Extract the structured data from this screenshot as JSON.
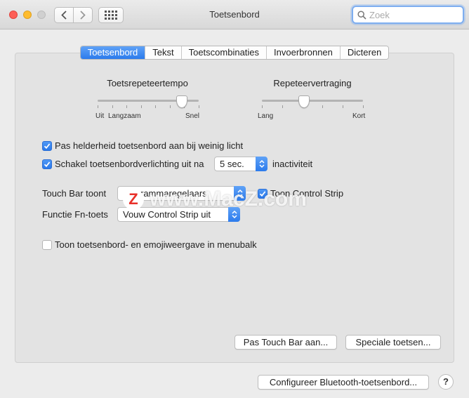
{
  "window": {
    "title": "Toetsenbord",
    "search_placeholder": "Zoek"
  },
  "tabs": [
    {
      "label": "Toetsenbord",
      "active": true
    },
    {
      "label": "Tekst",
      "active": false
    },
    {
      "label": "Toetscombinaties",
      "active": false
    },
    {
      "label": "Invoerbronnen",
      "active": false
    },
    {
      "label": "Dicteren",
      "active": false
    }
  ],
  "key_repeat": {
    "title": "Toetsrepeteertempo",
    "labels": [
      "Uit",
      "Langzaam",
      "Snel"
    ],
    "value_fraction": 0.83
  },
  "repeat_delay": {
    "title": "Repeteervertraging",
    "labels": [
      "Lang",
      "Kort"
    ],
    "value_fraction": 0.42
  },
  "options": {
    "brightness_label": "Pas helderheid toetsenbord aan bij weinig licht",
    "brightness_checked": true,
    "backlight_label": "Schakel toetsenbordverlichting uit na",
    "backlight_checked": true,
    "backlight_value": "5 sec.",
    "backlight_suffix": "inactiviteit"
  },
  "touchbar": {
    "label": "Touch Bar toont",
    "value": "rammaregelaars",
    "control_strip_label": "Toon Control Strip",
    "control_strip_checked": true
  },
  "fn_key": {
    "label": "Functie Fn-toets",
    "value": "Vouw Control Strip uit"
  },
  "menubar_option": {
    "label": "Toon toetsenbord- en emojiweergave in menubalk",
    "checked": false
  },
  "buttons": {
    "touchbar_customize": "Pas Touch Bar aan...",
    "special_keys": "Speciale toetsen...",
    "bluetooth": "Configureer Bluetooth-toetsenbord...",
    "help": "?"
  },
  "watermark": {
    "badge": "Z",
    "text": "www.MacZ.com"
  },
  "colors": {
    "accent": "#2c7bec",
    "window_bg": "#ececec",
    "panel_bg": "#e3e3e3"
  }
}
